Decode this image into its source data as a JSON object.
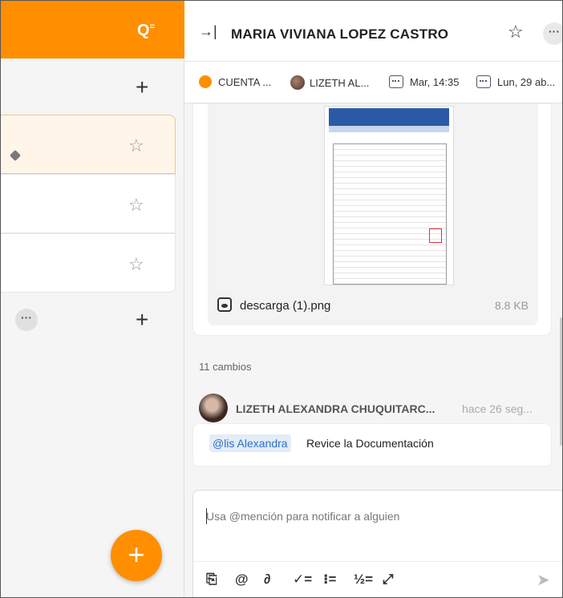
{
  "left_panel": {
    "search_filter_icon": "search-filter-icon",
    "add_icon": "+",
    "star_icon": "☆",
    "more_label": "···",
    "fab_label": "+"
  },
  "header": {
    "collapse_icon": "→|",
    "title": "MARIA VIVIANA LOPEZ CASTRO",
    "star_icon": "☆",
    "more_label": "···"
  },
  "chips": [
    {
      "label": "CUENTA ...",
      "icon": "orange-dot"
    },
    {
      "label": "LIZETH AL...",
      "icon": "avatar"
    },
    {
      "label": "Mar, 14:35",
      "icon": "calendar-icon"
    },
    {
      "label": "Lun, 29 ab...",
      "icon": "calendar-user-icon"
    }
  ],
  "attachment": {
    "file_name": "descarga (1).png",
    "file_size": "8.8 KB"
  },
  "activity": {
    "changes_label": "11 cambios",
    "comment": {
      "author": "LIZETH ALEXANDRA CHUQUITARC...",
      "time": "hace 26 seg...",
      "mention": "@lis Alexandra",
      "text": "Revice la Documentación"
    }
  },
  "composer": {
    "placeholder": "Usa @mención para notificar a alguien",
    "tools": [
      "paperclip-icon",
      "at-icon",
      "link-icon",
      "checklist-icon",
      "bullet-list-icon",
      "numbered-list-icon",
      "expand-icon"
    ],
    "send_icon": "send-icon"
  },
  "colors": {
    "accent": "#ff8f00",
    "mention_bg": "#e3ecf8",
    "mention_text": "#2f6fc6"
  }
}
